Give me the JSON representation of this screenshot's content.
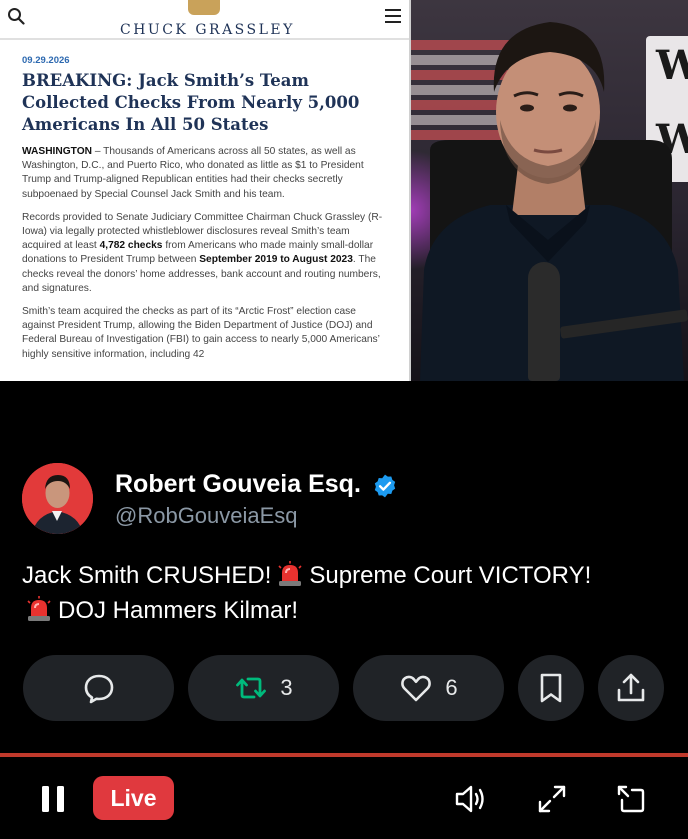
{
  "article": {
    "site_name": "CHUCK GRASSLEY",
    "date": "09.29.2026",
    "title": "BREAKING: Jack Smith’s Team Collected Checks From Nearly 5,000 Americans In All 50 States",
    "p1_lead": "WASHINGTON",
    "p1_text": " – Thousands of Americans across all 50 states, as well as Washington, D.C., and Puerto Rico, who donated as little as $1 to President Trump and Trump-aligned Republican entities had their checks secretly subpoenaed by Special Counsel Jack Smith and his team.",
    "p2_a": "Records provided to Senate Judiciary Committee Chairman Chuck Grassley (R-Iowa) via legally protected whistleblower disclosures reveal Smith’s team acquired at least ",
    "p2_b": "4,782 checks",
    "p2_c": " from Americans who made mainly small-dollar donations to President Trump between ",
    "p2_d": "September 2019 to August 2023",
    "p2_e": ". The checks reveal the donors’ home addresses, bank account and routing numbers, and signatures.",
    "p3": "Smith’s team acquired the checks as part of its “Arctic Frost” election case against President Trump, allowing the Biden Department of Justice (DOJ) and Federal Bureau of Investigation (FBI) to gain access to nearly 5,000 Americans’ highly sensitive information, including 42"
  },
  "post": {
    "display_name": "Robert Gouveia Esq.",
    "handle": "@RobGouveiaEsq",
    "text_part1": "Jack Smith CRUSHED!",
    "text_part2": "Supreme Court VICTORY!",
    "text_part3": "DOJ Hammers Kilmar!"
  },
  "actions": {
    "repost_count": "3",
    "like_count": "6"
  },
  "player": {
    "live_label": "Live"
  },
  "colors": {
    "accent_red": "#e0393e",
    "repost_green": "#00ba7c",
    "verified_blue": "#1d9bf0",
    "pill_bg": "#202327"
  },
  "icons": [
    "search-icon",
    "menu-icon",
    "verified-icon",
    "siren-icon",
    "reply-icon",
    "repost-icon",
    "like-icon",
    "bookmark-icon",
    "share-icon",
    "pause-icon",
    "volume-icon",
    "fullscreen-icon",
    "rotate-icon"
  ]
}
